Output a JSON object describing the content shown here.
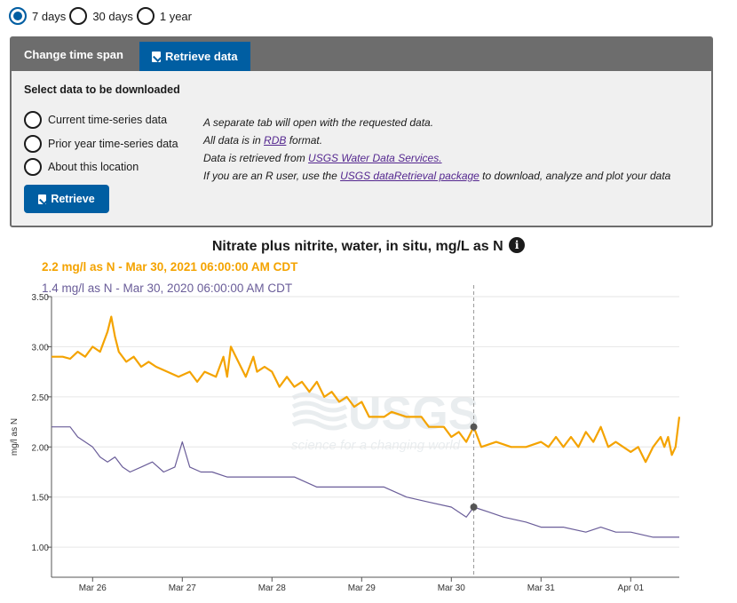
{
  "time_span": {
    "options": [
      "7 days",
      "30 days",
      "1 year"
    ],
    "selected": 0
  },
  "tabs": {
    "change_label": "Change time span",
    "retrieve_label": "Retrieve data"
  },
  "download": {
    "heading": "Select data to be downloaded",
    "options": [
      "Current time-series data",
      "Prior year time-series data",
      "About this location"
    ],
    "line1": "A separate tab will open with the requested data.",
    "line2_pre": "All data is in ",
    "line2_link": "RDB",
    "line2_post": " format.",
    "line3_pre": "Data is retrieved from ",
    "line3_link": "USGS Water Data Services.",
    "line4_pre": "If you are an R user, use the ",
    "line4_link": "USGS dataRetrieval package",
    "line4_post": " to download, analyze and plot your data",
    "button_label": "Retrieve"
  },
  "chart_title": "Nitrate plus nitrite, water, in situ, mg/L as N",
  "info_glyph": "i",
  "watermark": {
    "logo": "USGS",
    "tagline": "science for a changing world"
  },
  "legend": {
    "current": "2.2 mg/l as N - Mar 30, 2021 06:00:00 AM CDT",
    "prior": "1.4 mg/l as N - Mar 30, 2020 06:00:00 AM CDT"
  },
  "colors": {
    "current": "#f4a300",
    "prior": "#6a5d99",
    "accent": "#005ea2"
  },
  "chart_data": {
    "type": "line",
    "title": "Nitrate plus nitrite, water, in situ, mg/L as N",
    "ylabel": "mg/l as N",
    "ylim": [
      0.7,
      3.5
    ],
    "yticks": [
      "1.00",
      "1.50",
      "2.00",
      "2.50",
      "3.00",
      "3.50"
    ],
    "xticks": [
      "Mar 26",
      "Mar 27",
      "Mar 28",
      "Mar 29",
      "Mar 30",
      "Mar 31",
      "Apr 01"
    ],
    "xlim": [
      "2021-03-25T13:00",
      "2021-04-01T13:00"
    ],
    "cursor_x": "2021-03-30T06:00",
    "series": [
      {
        "name": "2.2 mg/l as N - Mar 30, 2021 06:00:00 AM CDT",
        "points": [
          [
            "2021-03-25T13:00",
            2.9
          ],
          [
            "2021-03-25T16:00",
            2.9
          ],
          [
            "2021-03-25T18:00",
            2.88
          ],
          [
            "2021-03-25T20:00",
            2.95
          ],
          [
            "2021-03-25T22:00",
            2.9
          ],
          [
            "2021-03-26T00:00",
            3.0
          ],
          [
            "2021-03-26T02:00",
            2.95
          ],
          [
            "2021-03-26T04:00",
            3.15
          ],
          [
            "2021-03-26T05:00",
            3.3
          ],
          [
            "2021-03-26T06:00",
            3.1
          ],
          [
            "2021-03-26T07:00",
            2.95
          ],
          [
            "2021-03-26T09:00",
            2.85
          ],
          [
            "2021-03-26T11:00",
            2.9
          ],
          [
            "2021-03-26T13:00",
            2.8
          ],
          [
            "2021-03-26T15:00",
            2.85
          ],
          [
            "2021-03-26T17:00",
            2.8
          ],
          [
            "2021-03-26T20:00",
            2.75
          ],
          [
            "2021-03-26T23:00",
            2.7
          ],
          [
            "2021-03-27T02:00",
            2.75
          ],
          [
            "2021-03-27T04:00",
            2.65
          ],
          [
            "2021-03-27T06:00",
            2.75
          ],
          [
            "2021-03-27T09:00",
            2.7
          ],
          [
            "2021-03-27T11:00",
            2.9
          ],
          [
            "2021-03-27T12:00",
            2.7
          ],
          [
            "2021-03-27T13:00",
            3.0
          ],
          [
            "2021-03-27T15:00",
            2.85
          ],
          [
            "2021-03-27T17:00",
            2.7
          ],
          [
            "2021-03-27T19:00",
            2.9
          ],
          [
            "2021-03-27T20:00",
            2.75
          ],
          [
            "2021-03-27T22:00",
            2.8
          ],
          [
            "2021-03-28T00:00",
            2.75
          ],
          [
            "2021-03-28T02:00",
            2.6
          ],
          [
            "2021-03-28T04:00",
            2.7
          ],
          [
            "2021-03-28T06:00",
            2.6
          ],
          [
            "2021-03-28T08:00",
            2.65
          ],
          [
            "2021-03-28T10:00",
            2.55
          ],
          [
            "2021-03-28T12:00",
            2.65
          ],
          [
            "2021-03-28T14:00",
            2.5
          ],
          [
            "2021-03-28T16:00",
            2.55
          ],
          [
            "2021-03-28T18:00",
            2.45
          ],
          [
            "2021-03-28T20:00",
            2.5
          ],
          [
            "2021-03-28T22:00",
            2.4
          ],
          [
            "2021-03-29T00:00",
            2.45
          ],
          [
            "2021-03-29T02:00",
            2.3
          ],
          [
            "2021-03-29T06:00",
            2.3
          ],
          [
            "2021-03-29T08:00",
            2.35
          ],
          [
            "2021-03-29T12:00",
            2.3
          ],
          [
            "2021-03-29T16:00",
            2.3
          ],
          [
            "2021-03-29T18:00",
            2.2
          ],
          [
            "2021-03-29T22:00",
            2.2
          ],
          [
            "2021-03-30T00:00",
            2.1
          ],
          [
            "2021-03-30T02:00",
            2.15
          ],
          [
            "2021-03-30T04:00",
            2.05
          ],
          [
            "2021-03-30T06:00",
            2.2
          ],
          [
            "2021-03-30T08:00",
            2.0
          ],
          [
            "2021-03-30T12:00",
            2.05
          ],
          [
            "2021-03-30T16:00",
            2.0
          ],
          [
            "2021-03-30T20:00",
            2.0
          ],
          [
            "2021-03-31T00:00",
            2.05
          ],
          [
            "2021-03-31T02:00",
            2.0
          ],
          [
            "2021-03-31T04:00",
            2.1
          ],
          [
            "2021-03-31T06:00",
            2.0
          ],
          [
            "2021-03-31T08:00",
            2.1
          ],
          [
            "2021-03-31T10:00",
            2.0
          ],
          [
            "2021-03-31T12:00",
            2.15
          ],
          [
            "2021-03-31T14:00",
            2.05
          ],
          [
            "2021-03-31T16:00",
            2.2
          ],
          [
            "2021-03-31T18:00",
            2.0
          ],
          [
            "2021-03-31T20:00",
            2.05
          ],
          [
            "2021-03-31T22:00",
            2.0
          ],
          [
            "2021-04-01T00:00",
            1.95
          ],
          [
            "2021-04-01T02:00",
            2.0
          ],
          [
            "2021-04-01T04:00",
            1.85
          ],
          [
            "2021-04-01T06:00",
            2.0
          ],
          [
            "2021-04-01T08:00",
            2.1
          ],
          [
            "2021-04-01T09:00",
            2.0
          ],
          [
            "2021-04-01T10:00",
            2.1
          ],
          [
            "2021-04-01T11:00",
            1.92
          ],
          [
            "2021-04-01T12:00",
            2.0
          ],
          [
            "2021-04-01T13:00",
            2.3
          ]
        ]
      },
      {
        "name": "1.4 mg/l as N - Mar 30, 2020 06:00:00 AM CDT",
        "points": [
          [
            "2021-03-25T13:00",
            2.2
          ],
          [
            "2021-03-25T18:00",
            2.2
          ],
          [
            "2021-03-25T20:00",
            2.1
          ],
          [
            "2021-03-25T22:00",
            2.05
          ],
          [
            "2021-03-26T00:00",
            2.0
          ],
          [
            "2021-03-26T02:00",
            1.9
          ],
          [
            "2021-03-26T04:00",
            1.85
          ],
          [
            "2021-03-26T06:00",
            1.9
          ],
          [
            "2021-03-26T08:00",
            1.8
          ],
          [
            "2021-03-26T10:00",
            1.75
          ],
          [
            "2021-03-26T13:00",
            1.8
          ],
          [
            "2021-03-26T16:00",
            1.85
          ],
          [
            "2021-03-26T19:00",
            1.75
          ],
          [
            "2021-03-26T22:00",
            1.8
          ],
          [
            "2021-03-27T00:00",
            2.05
          ],
          [
            "2021-03-27T02:00",
            1.8
          ],
          [
            "2021-03-27T05:00",
            1.75
          ],
          [
            "2021-03-27T08:00",
            1.75
          ],
          [
            "2021-03-27T12:00",
            1.7
          ],
          [
            "2021-03-27T18:00",
            1.7
          ],
          [
            "2021-03-28T00:00",
            1.7
          ],
          [
            "2021-03-28T06:00",
            1.7
          ],
          [
            "2021-03-28T12:00",
            1.6
          ],
          [
            "2021-03-28T18:00",
            1.6
          ],
          [
            "2021-03-29T00:00",
            1.6
          ],
          [
            "2021-03-29T06:00",
            1.6
          ],
          [
            "2021-03-29T12:00",
            1.5
          ],
          [
            "2021-03-29T18:00",
            1.45
          ],
          [
            "2021-03-30T00:00",
            1.4
          ],
          [
            "2021-03-30T04:00",
            1.3
          ],
          [
            "2021-03-30T06:00",
            1.4
          ],
          [
            "2021-03-30T10:00",
            1.35
          ],
          [
            "2021-03-30T14:00",
            1.3
          ],
          [
            "2021-03-30T20:00",
            1.25
          ],
          [
            "2021-03-31T00:00",
            1.2
          ],
          [
            "2021-03-31T06:00",
            1.2
          ],
          [
            "2021-03-31T12:00",
            1.15
          ],
          [
            "2021-03-31T16:00",
            1.2
          ],
          [
            "2021-03-31T20:00",
            1.15
          ],
          [
            "2021-04-01T00:00",
            1.15
          ],
          [
            "2021-04-01T06:00",
            1.1
          ],
          [
            "2021-04-01T13:00",
            1.1
          ]
        ]
      }
    ]
  }
}
